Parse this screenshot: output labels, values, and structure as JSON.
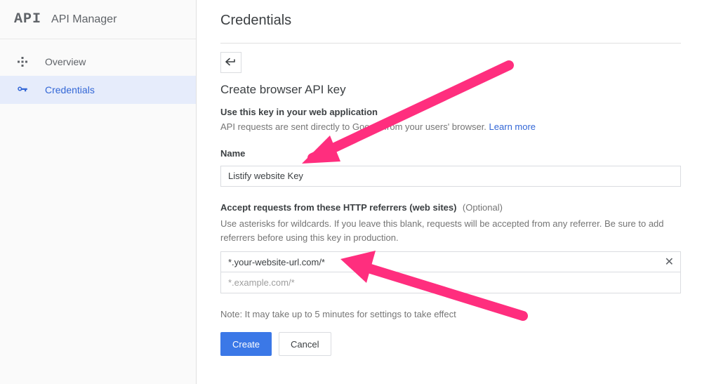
{
  "header": {
    "logo": "API",
    "title": "API Manager"
  },
  "sidebar": {
    "items": [
      {
        "label": "Overview"
      },
      {
        "label": "Credentials"
      }
    ]
  },
  "page": {
    "title": "Credentials",
    "section_title": "Create browser API key",
    "usage_bold": "Use this key in your web application",
    "usage_help": "API requests are sent directly to Google from your users' browser. ",
    "learn_more": "Learn more"
  },
  "name_field": {
    "label": "Name",
    "value": "Listify website Key"
  },
  "referrers": {
    "label": "Accept requests from these HTTP referrers (web sites)",
    "optional": "(Optional)",
    "help": "Use asterisks for wildcards. If you leave this blank, requests will be accepted from any referrer. Be sure to add referrers before using this key in production.",
    "item_value": "*.your-website-url.com/*",
    "placeholder": "*.example.com/*"
  },
  "note": "Note: It may take up to 5 minutes for settings to take effect",
  "buttons": {
    "create": "Create",
    "cancel": "Cancel"
  }
}
